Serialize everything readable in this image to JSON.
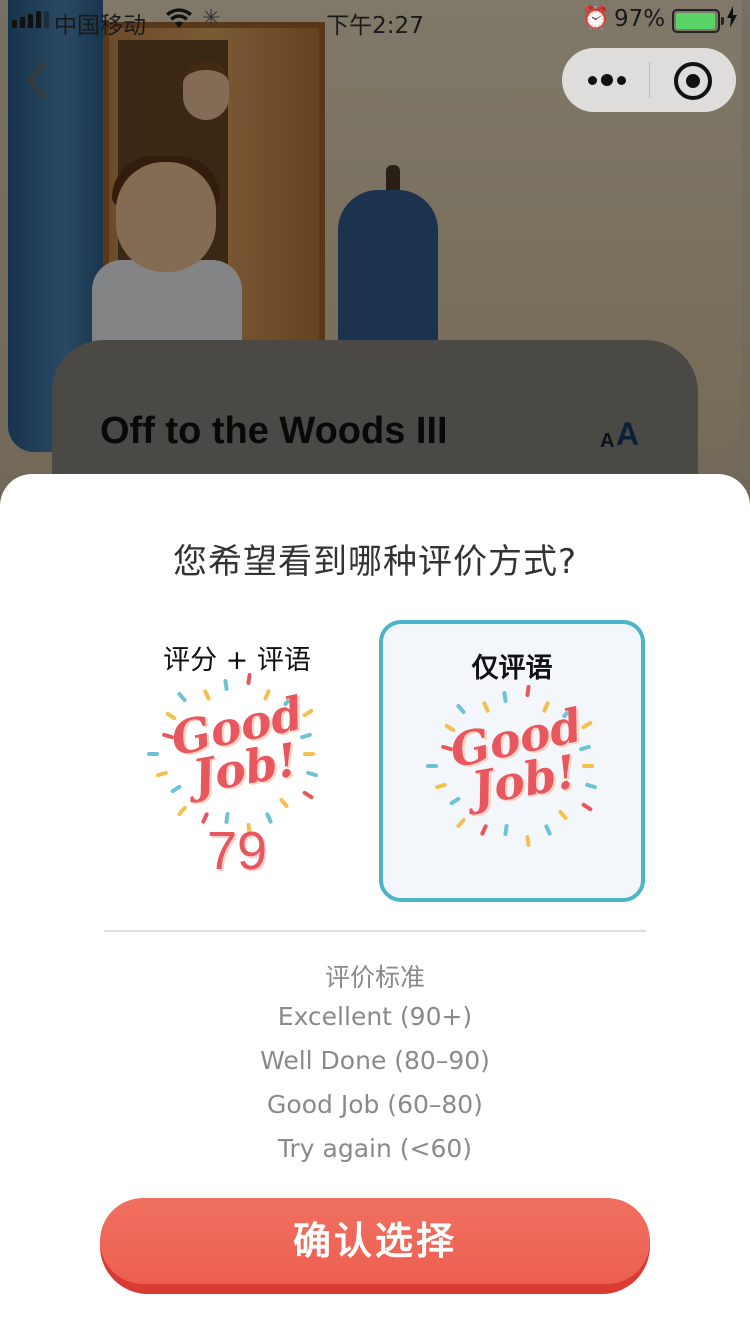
{
  "status_bar": {
    "carrier": "中国移动",
    "time": "下午2:27",
    "battery_percent": "97%",
    "battery_level": 0.97
  },
  "book": {
    "title": "Off to the Woods III",
    "font_size_small": "A",
    "font_size_big": "A"
  },
  "sheet": {
    "question": "您希望看到哪种评价方式?",
    "options": [
      {
        "label": "评分 + 评语",
        "badge_line1": "Good",
        "badge_line2": "Job!",
        "score": "79",
        "selected": false
      },
      {
        "label": "仅评语",
        "badge_line1": "Good",
        "badge_line2": "Job!",
        "selected": true
      }
    ],
    "criteria": {
      "title": "评价标准",
      "items": [
        "Excellent (90+)",
        "Well Done (80–90)",
        "Good Job (60–80)",
        "Try again (<60)"
      ]
    },
    "confirm_label": "确认选择"
  },
  "colors": {
    "accent_red": "#ec5f50",
    "selected_border": "#4bb4c6",
    "badge_red": "#e8575d"
  }
}
